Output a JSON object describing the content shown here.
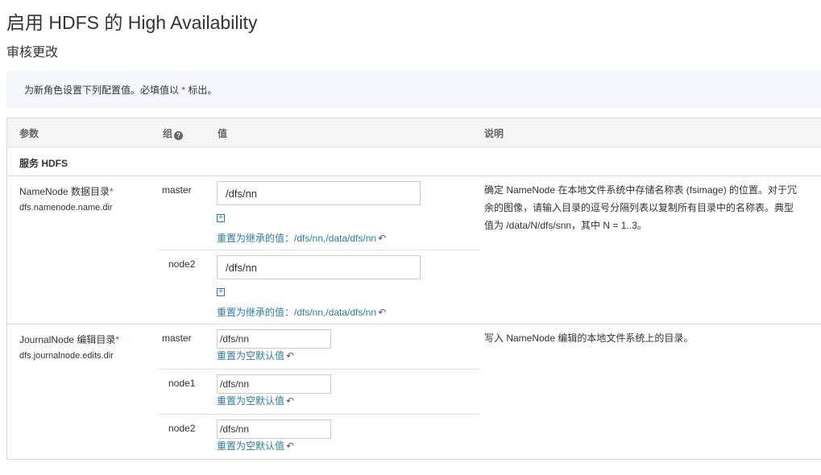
{
  "page": {
    "title": "启用 HDFS 的 High Availability",
    "subtitle": "审核更改"
  },
  "info": {
    "text_before": "为新角色设置下列配置值。必填值以",
    "star": "*",
    "text_after": "标出。"
  },
  "table": {
    "headers": {
      "param": "参数",
      "group": "组",
      "value": "值",
      "desc": "说明"
    },
    "service_label": "服务 HDFS",
    "rows": [
      {
        "name": "NameNode 数据目录",
        "required_mark": "*",
        "key": "dfs.namenode.name.dir",
        "description": "确定 NameNode 在本地文件系统中存储名称表 (fsimage) 的位置。对于冗余的图像，请输入目录的逗号分隔列表以复制所有目录中的名称表。典型值为 /data/N/dfs/snn，其中 N = 1..3。",
        "groups": [
          {
            "label": "master",
            "value": "/dfs/nn",
            "add_icon": "⊞",
            "reset_text": "重置为继承的值：/dfs/nn,/data/dfs/nn",
            "undo_icon": "undo-icon"
          },
          {
            "label": "node2",
            "value": "/dfs/nn",
            "add_icon": "⊞",
            "reset_text": "重置为继承的值：/dfs/nn,/data/dfs/nn",
            "undo_icon": "undo-icon"
          }
        ]
      },
      {
        "name": "JournalNode 编辑目录",
        "required_mark": "*",
        "key": "dfs.journalnode.edits.dir",
        "description": "写入 NameNode 编辑的本地文件系统上的目录。",
        "groups": [
          {
            "label": "master",
            "value": "/dfs/nn",
            "reset_text": "重置为空默认值"
          },
          {
            "label": "node1",
            "value": "/dfs/nn",
            "reset_text": "重置为空默认值"
          },
          {
            "label": "node2",
            "value": "/dfs/nn",
            "reset_text": "重置为空默认值"
          }
        ]
      }
    ]
  }
}
